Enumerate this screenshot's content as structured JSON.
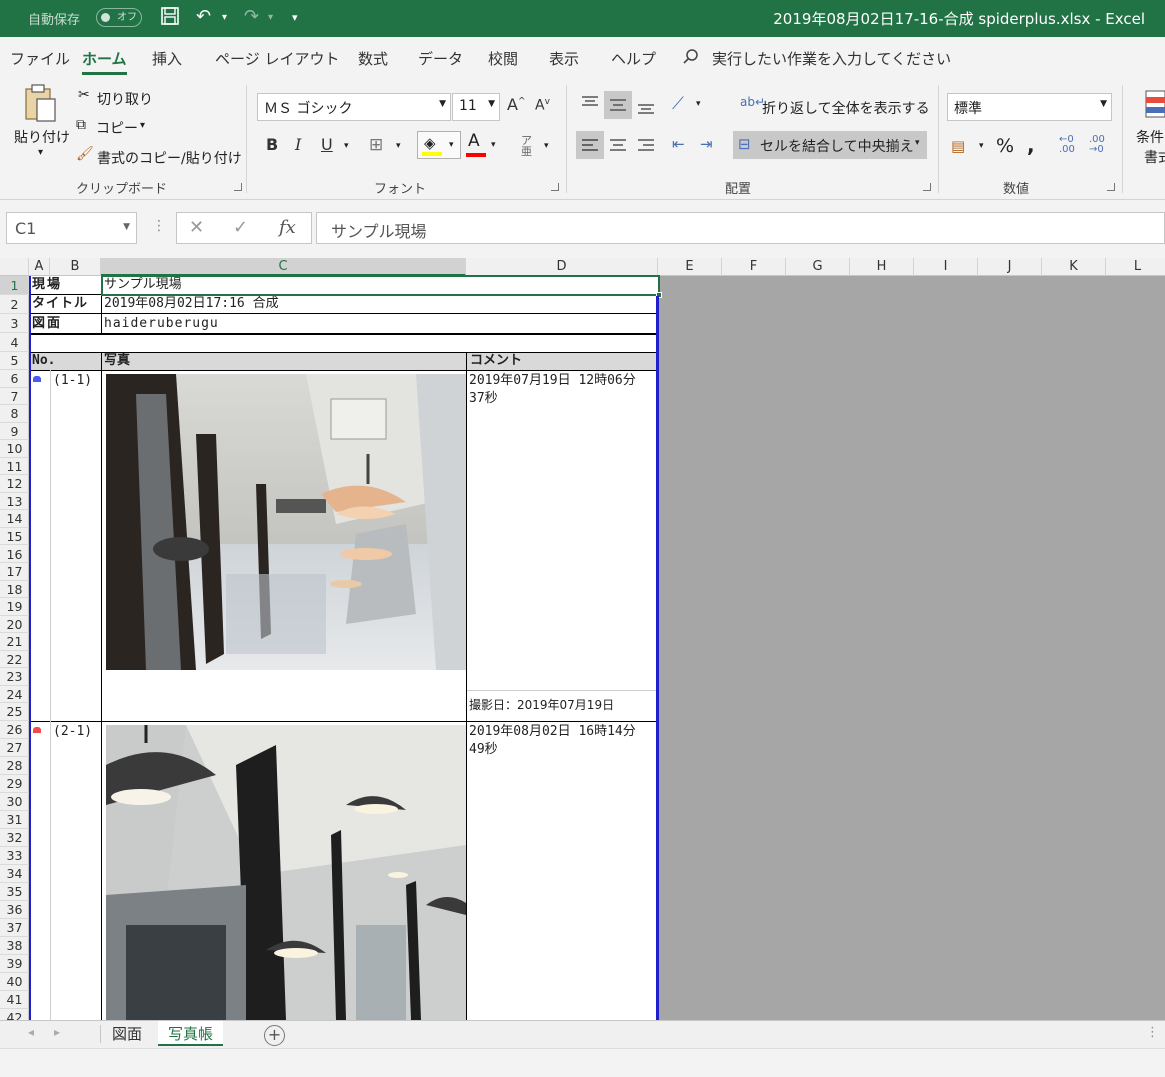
{
  "titlebar": {
    "autosave_label": "自動保存",
    "autosave_state": "オフ",
    "document": "2019年08月02日17-16-合成 spiderplus.xlsx - Excel"
  },
  "tabs": [
    "ファイル",
    "ホーム",
    "挿入",
    "ページ レイアウト",
    "数式",
    "データ",
    "校閲",
    "表示",
    "ヘルプ"
  ],
  "tell_me": "実行したい作業を入力してください",
  "ribbon": {
    "clipboard": {
      "paste": "貼り付け",
      "cut": "切り取り",
      "copy": "コピー",
      "format_painter": "書式のコピー/貼り付け",
      "label": "クリップボード"
    },
    "font": {
      "name": "ＭＳ ゴシック",
      "size": "11",
      "bold": "B",
      "italic": "I",
      "underline": "U",
      "label": "フォント"
    },
    "alignment": {
      "wrap_text": "折り返して全体を表示する",
      "merge_center": "セルを結合して中央揃え",
      "label": "配置"
    },
    "number": {
      "format": "標準",
      "label": "数値"
    },
    "styles": {
      "conditional_1": "条件",
      "conditional_2": "書式"
    }
  },
  "formula_bar": {
    "name_box": "C1",
    "content": "サンプル現場"
  },
  "columns": [
    "A",
    "B",
    "C",
    "D",
    "E",
    "F",
    "G",
    "H",
    "I",
    "J",
    "K",
    "L"
  ],
  "rows": [
    "1",
    "2",
    "3",
    "4",
    "5",
    "6",
    "7",
    "8",
    "9",
    "10",
    "11",
    "12",
    "13",
    "14",
    "15",
    "16",
    "17",
    "18",
    "19",
    "20",
    "21",
    "22",
    "23",
    "24",
    "25",
    "26",
    "27",
    "28",
    "29",
    "30",
    "31",
    "32",
    "33",
    "34",
    "35",
    "36",
    "37",
    "38",
    "39",
    "40",
    "41",
    "42"
  ],
  "sheet": {
    "header": {
      "site_label": "現場",
      "site_value": "サンプル現場",
      "title_label": "タイトル",
      "title_value": "2019年08月02日17:16 合成",
      "drawing_label": "図面",
      "drawing_value": "haideruberugu"
    },
    "table_headers": {
      "no": "No.",
      "photo": "写真",
      "comment": "コメント"
    },
    "entries": [
      {
        "marker_color": "#4a5cf0",
        "id": "(1-1)",
        "comment_line1": "2019年07月19日 12時06分",
        "comment_line2": "37秒",
        "footer": "撮影日：2019年07月19日"
      },
      {
        "marker_color": "#f04a4a",
        "id": "(2-1)",
        "comment_line1": "2019年08月02日 16時14分",
        "comment_line2": "49秒"
      }
    ]
  },
  "sheet_tabs": [
    "図面",
    "写真帳"
  ],
  "colors": {
    "excel_green": "#217346",
    "selection_blue": "#1f1fcc"
  }
}
